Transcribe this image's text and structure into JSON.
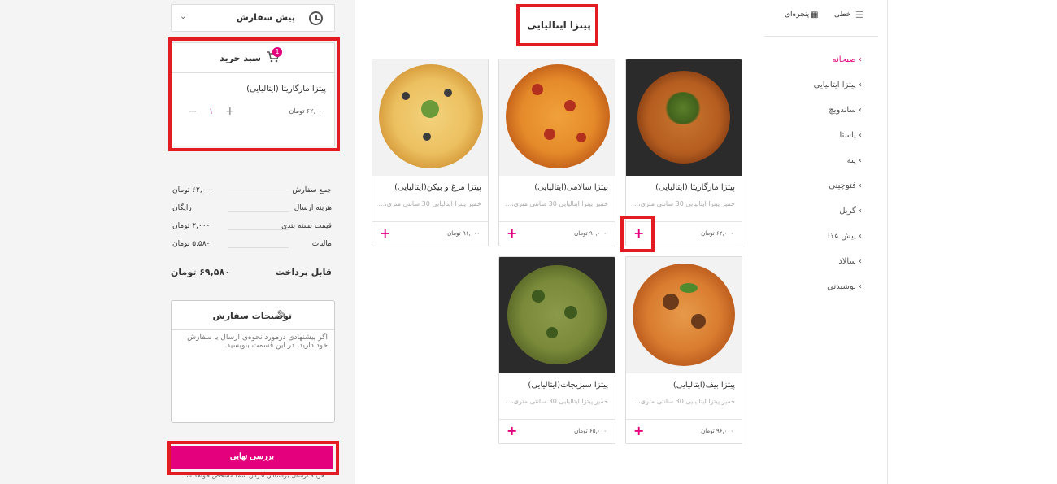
{
  "preorder": {
    "label": "پیش سفارش"
  },
  "cart": {
    "title": "سبد خرید",
    "badge": "1",
    "item_name": "پیتزا مارگاریتا (ایتالیایی)",
    "item_price": "۶۲,۰۰۰ تومان",
    "qty": "۱",
    "minus": "−",
    "plus": "+"
  },
  "summary": {
    "rows": [
      {
        "label": "جمع سفارش",
        "value": "۶۲,۰۰۰ تومان"
      },
      {
        "label": "هزینه ارسال",
        "value": "رایگان"
      },
      {
        "label": "قیمت بسته بندی",
        "value": "۲,۰۰۰ تومان"
      },
      {
        "label": "مالیات",
        "value": "۵,۵۸۰ تومان"
      }
    ],
    "payable_label": "قابل پرداخت",
    "payable_value": "۶۹,۵۸۰ تومان"
  },
  "notes": {
    "title": "توضیحات سفارش",
    "placeholder": "اگر پیشنهادی درمورد نحوه‌ی ارسال یا سفارش خود دارید، در این قسمت بنویسید."
  },
  "review_button": "بررسی نهایی",
  "footnote": "هزینه ارسال براساس آدرس شما مشخص خواهد شد",
  "category_title": "پیتزا ایتالیایی",
  "products": [
    {
      "name": "پیتزا مارگاریتا (ایتالیایی)",
      "desc": "خمیر پیتزا ایتالیایی 30 سانتی متری،...",
      "price": "۶۲,۰۰۰ تومان",
      "plus": "+"
    },
    {
      "name": "پیتزا سالامی(ایتالیایی)",
      "desc": "خمیر پیتزا ایتالیایی 30 سانتی متری،...",
      "price": "۹۰,۰۰۰ تومان",
      "plus": "+"
    },
    {
      "name": "پیتزا مرغ و بیکن(ایتالیایی)",
      "desc": "خمیر پیتزا ایتالیایی 30 سانتی متری،...",
      "price": "۹۱,۰۰۰ تومان",
      "plus": "+"
    },
    {
      "name": "پیتزا بیف(ایتالیایی)",
      "desc": "خمیر پیتزا ایتالیایی 30 سانتی متری،...",
      "price": "۹۶,۰۰۰ تومان",
      "plus": "+"
    },
    {
      "name": "پیتزا سبزیجات(ایتالیایی)",
      "desc": "خمیر پیتزا ایتالیایی 30 سانتی متری،...",
      "price": "۶۵,۰۰۰ تومان",
      "plus": "+"
    }
  ],
  "view": {
    "grid_label": "پنجره‌ای",
    "list_label": "خطی"
  },
  "nav": [
    {
      "label": "› صبحانه",
      "active": true
    },
    {
      "label": "› پیتزا ایتالیایی"
    },
    {
      "label": "› ساندویچ"
    },
    {
      "label": "› پاستا"
    },
    {
      "label": "› پنه"
    },
    {
      "label": "› فتوچینی"
    },
    {
      "label": "› گریل"
    },
    {
      "label": "› پیش غذا"
    },
    {
      "label": "› سالاد"
    },
    {
      "label": "› نوشیدنی"
    }
  ],
  "colors": {
    "accent": "#e4007c",
    "highlight": "#e31b23"
  }
}
